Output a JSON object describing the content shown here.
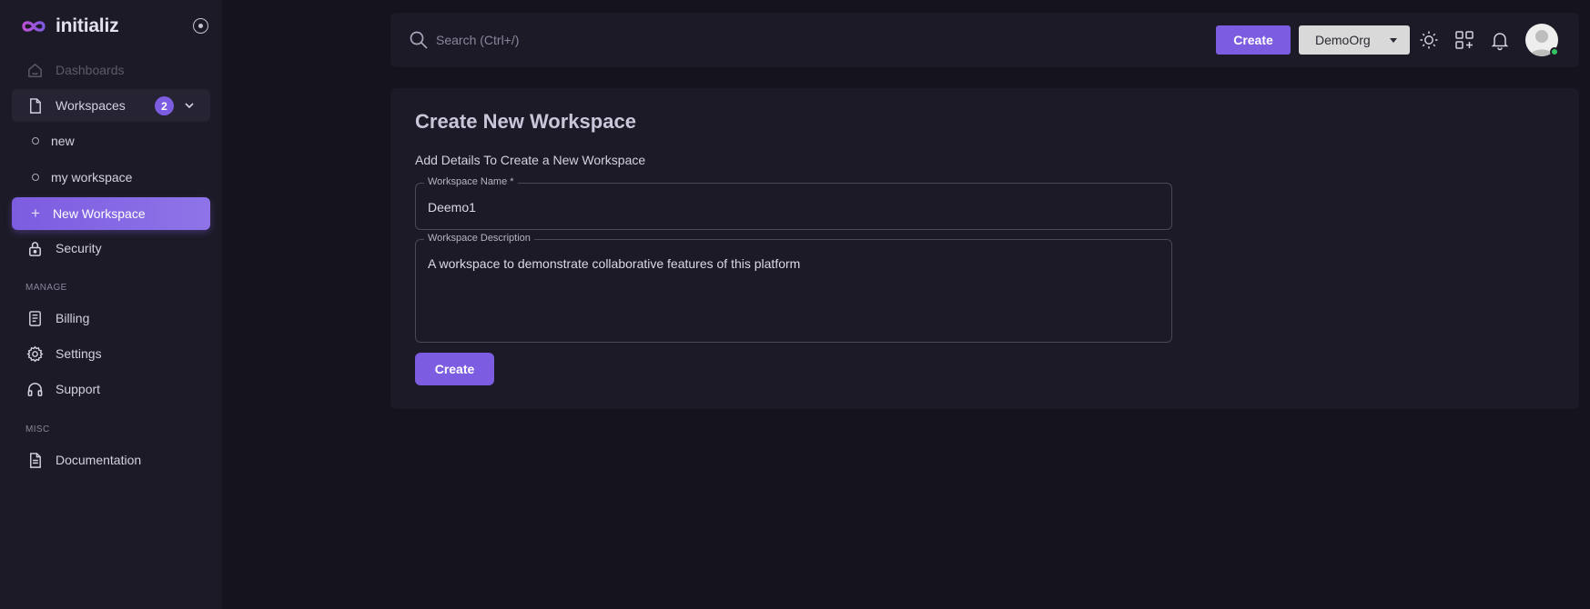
{
  "brand": {
    "name": "initializ",
    "logo_icon": "infinity-logo-icon"
  },
  "sidebar": {
    "dashboards": "Dashboards",
    "workspaces": {
      "label": "Workspaces",
      "count": "2"
    },
    "workspace_items": [
      "new",
      "my workspace"
    ],
    "new_workspace": "New Workspace",
    "security": "Security",
    "manage_label": "MANAGE",
    "billing": "Billing",
    "settings": "Settings",
    "support": "Support",
    "misc_label": "MISC",
    "documentation": "Documentation"
  },
  "topbar": {
    "search_placeholder": "Search (Ctrl+/)",
    "create_label": "Create",
    "org": "DemoOrg"
  },
  "form": {
    "title": "Create New Workspace",
    "subtitle": "Add Details To Create a New Workspace",
    "name_label": "Workspace Name *",
    "name_value": "Deemo1",
    "description_label": "Workspace Description",
    "description_value": "A workspace to demonstrate collaborative features of this platform",
    "submit_label": "Create"
  },
  "colors": {
    "accent": "#7c5ce0",
    "background": "#15131d",
    "surface": "#1c1a26",
    "status_online": "#33c463"
  }
}
